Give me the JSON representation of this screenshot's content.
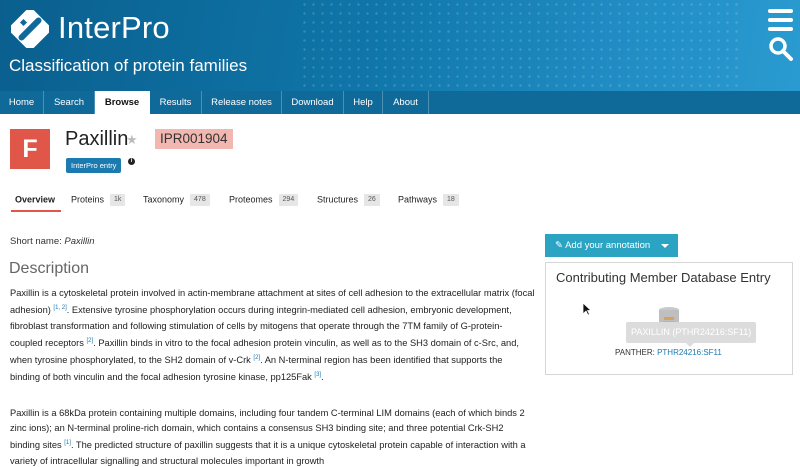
{
  "header": {
    "brand": "InterPro",
    "tagline": "Classification of protein families",
    "icons": [
      "interpro-logo-icon",
      "hamburger-menu-icon",
      "search-icon"
    ]
  },
  "nav": {
    "items": [
      {
        "label": "Home",
        "active": false
      },
      {
        "label": "Search",
        "active": false
      },
      {
        "label": "Browse",
        "active": true
      },
      {
        "label": "Results",
        "active": false
      },
      {
        "label": "Release notes",
        "active": false
      },
      {
        "label": "Download",
        "active": false
      },
      {
        "label": "Help",
        "active": false
      },
      {
        "label": "About",
        "active": false
      }
    ]
  },
  "entry": {
    "badge_letter": "F",
    "name": "Paxillin",
    "accession": "IPR001904",
    "type_label": "InterPro entry",
    "info_symbol": "i"
  },
  "tabs": [
    {
      "label": "Overview",
      "count": "",
      "active": true
    },
    {
      "label": "Proteins",
      "count": "1k"
    },
    {
      "label": "Taxonomy",
      "count": "478"
    },
    {
      "label": "Proteomes",
      "count": "294"
    },
    {
      "label": "Structures",
      "count": "26"
    },
    {
      "label": "Pathways",
      "count": "18"
    }
  ],
  "main": {
    "short_name_label": "Short name: ",
    "short_name": "Paxillin",
    "description_heading": "Description",
    "paragraphs": [
      {
        "segments": [
          {
            "text": "Paxillin is a cytoskeletal protein involved in actin-membrane attachment at sites of cell adhesion to the extracellular matrix (focal adhesion) "
          },
          {
            "ref": "[1, 2]"
          },
          {
            "text": ". Extensive tyrosine phosphorylation occurs during integrin-mediated cell adhesion, embryonic development, fibroblast transformation and following stimulation of cells by mitogens that operate through the 7TM family of G-protein-coupled receptors "
          },
          {
            "ref": "[2]"
          },
          {
            "text": ". Paxillin binds in vitro to the focal adhesion protein vinculin, as well as to the SH3 domain of c-Src, and, when tyrosine phosphorylated, to the SH2 domain of v-Crk "
          },
          {
            "ref": "[2]"
          },
          {
            "text": ". An N-terminal region has been identified that supports the binding of both vinculin and the focal adhesion tyrosine kinase, pp125Fak "
          },
          {
            "ref": "[3]"
          },
          {
            "text": "."
          }
        ]
      },
      {
        "segments": [
          {
            "text": "Paxillin is a 68kDa protein containing multiple domains, including four tandem C-terminal LIM domains (each of which binds 2 zinc ions); an N-terminal proline-rich domain, which contains a consensus SH3 binding site; and three potential Crk-SH2 binding sites "
          },
          {
            "ref": "[1]"
          },
          {
            "text": ". The predicted structure of paxillin suggests that it is a unique cytoskeletal protein capable of interaction with a variety of intracellular signalling and structural molecules important in growth"
          }
        ]
      }
    ]
  },
  "side": {
    "annotation_button": "Add your annotation",
    "panel_title": "Contributing Member Database Entry",
    "tooltip": "PAXILLIN (PTHR24216:SF11)",
    "member_db": "PANTHER: ",
    "member_accession": "PTHR24216:SF11"
  },
  "colors": {
    "header_blue": "#0f75a8",
    "nav_blue": "#0f6a9a",
    "family_badge": "#e0574a",
    "accession_bg": "#f2b7b0",
    "annotation_button": "#2aa4c2",
    "link": "#1b7ab0"
  }
}
